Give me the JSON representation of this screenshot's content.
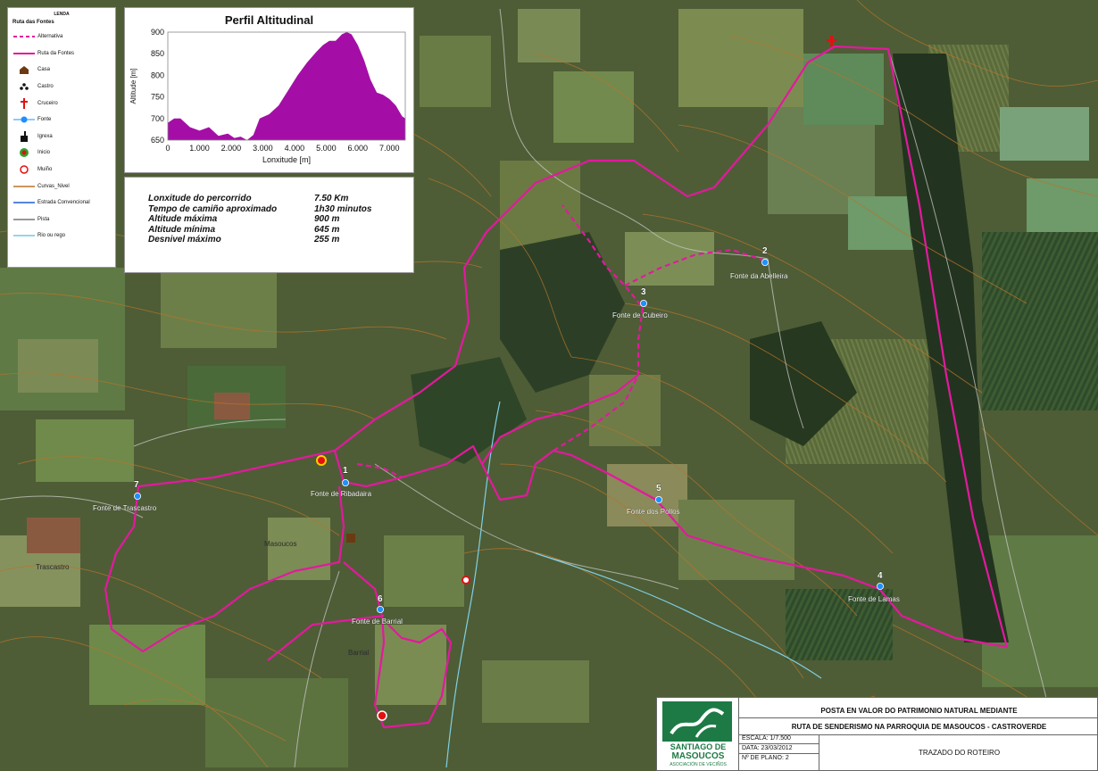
{
  "legend": {
    "header": "LENDA",
    "group": "Ruta das Fontes",
    "items": [
      {
        "label": "Alternativa",
        "icon": "dashed-magenta-line-icon"
      },
      {
        "label": "Ruta da Fontes",
        "icon": "magenta-line-icon"
      },
      {
        "label": "Casa",
        "icon": "house-icon"
      },
      {
        "label": "Castro",
        "icon": "castro-dots-icon"
      },
      {
        "label": "Cruceiro",
        "icon": "cross-icon"
      },
      {
        "label": "Fonte",
        "icon": "fountain-point-icon"
      },
      {
        "label": "Igrexa",
        "icon": "church-icon"
      },
      {
        "label": "Inicio",
        "icon": "start-point-icon"
      },
      {
        "label": "Muiño",
        "icon": "mill-circle-icon"
      },
      {
        "label": "Curvas_Nivel",
        "icon": "contour-line-icon"
      },
      {
        "label": "Estrada Convencional",
        "icon": "road-line-icon"
      },
      {
        "label": "Pista",
        "icon": "track-line-icon"
      },
      {
        "label": "Rio ou rego",
        "icon": "river-line-icon"
      }
    ]
  },
  "profile": {
    "title": "Perfil Altitudinal",
    "chart_data": {
      "type": "area",
      "xlabel": "Lonxitude [m]",
      "ylabel": "Altitude [m]",
      "xlim": [
        0,
        7500
      ],
      "ylim": [
        650,
        900
      ],
      "x_ticks": [
        "0",
        "1.000",
        "2.000",
        "3.000",
        "4.000",
        "5.000",
        "6.000",
        "7.000"
      ],
      "y_ticks": [
        "650",
        "700",
        "750",
        "800",
        "850",
        "900"
      ],
      "x": [
        0,
        200,
        400,
        700,
        1000,
        1300,
        1600,
        1900,
        2100,
        2300,
        2500,
        2700,
        2900,
        3200,
        3500,
        3800,
        4100,
        4400,
        4700,
        4900,
        5100,
        5300,
        5500,
        5650,
        5800,
        6000,
        6200,
        6400,
        6600,
        6800,
        7000,
        7200,
        7400,
        7500
      ],
      "y": [
        690,
        700,
        700,
        680,
        672,
        680,
        660,
        665,
        655,
        658,
        650,
        662,
        700,
        710,
        730,
        765,
        800,
        830,
        855,
        870,
        880,
        880,
        895,
        900,
        895,
        870,
        835,
        790,
        760,
        755,
        745,
        730,
        705,
        700
      ],
      "color": "#a40ea6"
    }
  },
  "stats": [
    {
      "label": "Lonxitude do percorrido",
      "value": "7.50 Km"
    },
    {
      "label": "Tempo de camiño aproximado",
      "value": "1h30 minutos"
    },
    {
      "label": "Altitude máxima",
      "value": "900 m"
    },
    {
      "label": "Altitude mínima",
      "value": "645 m"
    },
    {
      "label": "Desnivel máximo",
      "value": "255 m"
    }
  ],
  "fountains": [
    {
      "num": "1",
      "name": "Fonte de Ribadaira"
    },
    {
      "num": "2",
      "name": "Fonte da Abelleira"
    },
    {
      "num": "3",
      "name": "Fonte de Cubeiro"
    },
    {
      "num": "4",
      "name": "Fonte de Lamas"
    },
    {
      "num": "5",
      "name": "Fonte dos Pollos"
    },
    {
      "num": "6",
      "name": "Fonte de Barrial"
    },
    {
      "num": "7",
      "name": "Fonte de Trascastro"
    }
  ],
  "places": {
    "masoucos": "Masoucos",
    "barrial": "Barrial",
    "trascastro": "Trascastro"
  },
  "title_block": {
    "logo_line1": "SANTIAGO DE",
    "logo_line2": "MASOUCOS",
    "logo_line3": "ASOCIACIÓN DE VECIÑOS",
    "title1": "POSTA EN VALOR DO PATRIMONIO NATURAL MEDIANTE",
    "title2": "RUTA DE SENDERISMO NA PARROQUIA DE MASOUCOS - CASTROVERDE",
    "scale": "ESCALA: 1/7.500",
    "date": "DATA: 23/03/2012",
    "plan": "Nº DE PLANO: 2",
    "description": "TRAZADO DO ROTEIRO"
  },
  "colors": {
    "route": "#e3199e",
    "fountain": "#1e90ff",
    "contour": "#b8742a",
    "profile_fill": "#a40ea6"
  }
}
